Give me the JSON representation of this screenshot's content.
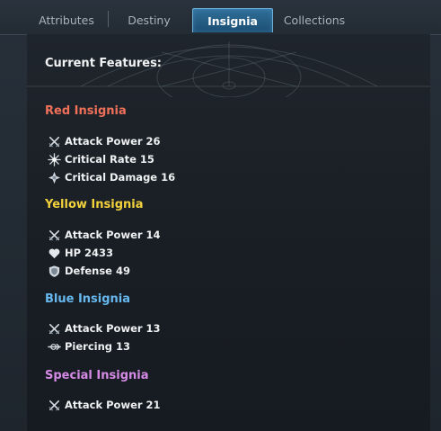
{
  "tabs": [
    {
      "label": "Attributes",
      "active": false
    },
    {
      "label": "Destiny",
      "active": false
    },
    {
      "label": "Insignia",
      "active": true
    },
    {
      "label": "Collections",
      "active": false
    }
  ],
  "header": {
    "title": "Current Features:"
  },
  "groups": [
    {
      "title": "Red Insignia",
      "color": "#f0705a",
      "stats": [
        {
          "icon": "crossed-swords-icon",
          "text": "Attack Power 26"
        },
        {
          "icon": "critical-burst-icon",
          "text": "Critical Rate 15"
        },
        {
          "icon": "critical-damage-icon",
          "text": "Critical Damage 16"
        }
      ]
    },
    {
      "title": "Yellow Insignia",
      "color": "#f2d13c",
      "stats": [
        {
          "icon": "crossed-swords-icon",
          "text": "Attack Power 14"
        },
        {
          "icon": "heart-icon",
          "text": "HP 2433"
        },
        {
          "icon": "shield-icon",
          "text": "Defense 49"
        }
      ]
    },
    {
      "title": "Blue Insignia",
      "color": "#66b8ee",
      "stats": [
        {
          "icon": "crossed-swords-icon",
          "text": "Attack Power 13"
        },
        {
          "icon": "piercing-icon",
          "text": "Piercing 13"
        }
      ]
    },
    {
      "title": "Special Insignia",
      "color": "#d58be6",
      "stats": [
        {
          "icon": "crossed-swords-icon",
          "text": "Attack Power 21"
        }
      ]
    }
  ]
}
